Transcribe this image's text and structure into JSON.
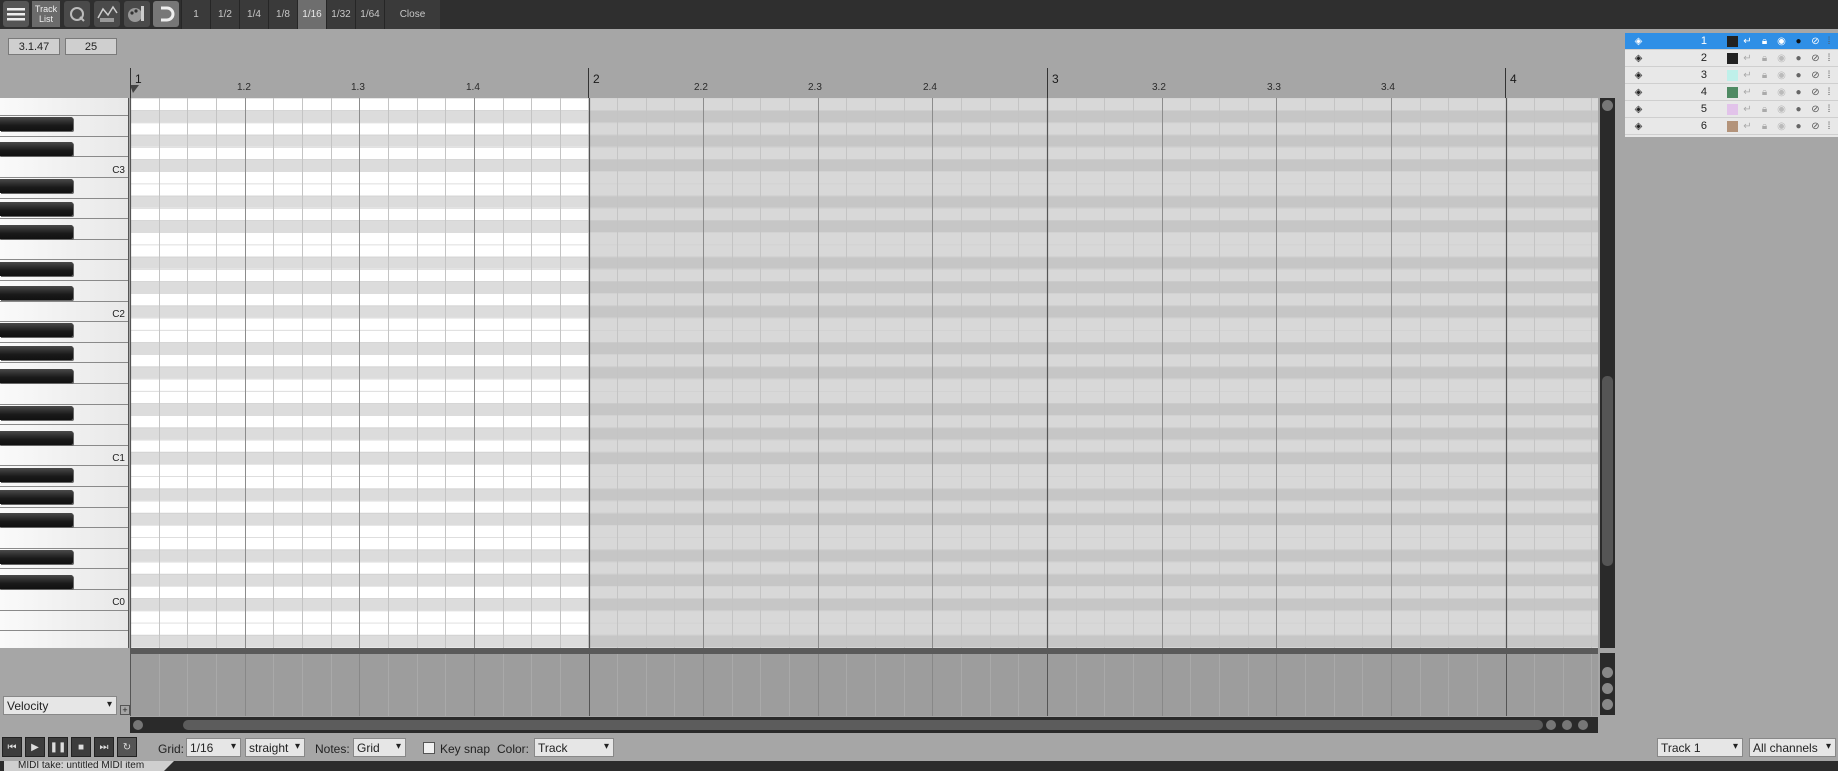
{
  "toolbar": {
    "track_list_label_1": "Track",
    "track_list_label_2": "List",
    "grid_buttons": [
      "1",
      "1/2",
      "1/4",
      "1/8",
      "1/16",
      "1/32",
      "1/64"
    ],
    "active_grid": "1/16",
    "close_label": "Close"
  },
  "readouts": {
    "position": "3.1.47",
    "value": "25"
  },
  "ruler": {
    "bars": [
      "1",
      "2",
      "3",
      "4"
    ],
    "beats": [
      "1.2",
      "1.3",
      "1.4",
      "2.2",
      "2.3",
      "2.4",
      "3.2",
      "3.3",
      "3.4"
    ]
  },
  "piano": {
    "labels": [
      "C3",
      "C2",
      "C1",
      "C0"
    ]
  },
  "cc": {
    "lane_select": "Velocity"
  },
  "tracks": [
    {
      "num": "1",
      "color": "#222222",
      "selected": true
    },
    {
      "num": "2",
      "color": "#222222",
      "selected": false
    },
    {
      "num": "3",
      "color": "#bff0ea",
      "selected": false
    },
    {
      "num": "4",
      "color": "#4f8a63",
      "selected": false
    },
    {
      "num": "5",
      "color": "#e2c3ea",
      "selected": false
    },
    {
      "num": "6",
      "color": "#b3937a",
      "selected": false
    }
  ],
  "bottom": {
    "grid_label": "Grid:",
    "grid_value": "1/16",
    "swing_value": "straight",
    "notes_label": "Notes:",
    "notes_value": "Grid",
    "key_snap_label": "Key snap",
    "color_label": "Color:",
    "color_value": "Track",
    "track_value": "Track 1",
    "channels_value": "All channels"
  },
  "status": {
    "tab_label": "MIDI take: untitled MIDI item"
  }
}
